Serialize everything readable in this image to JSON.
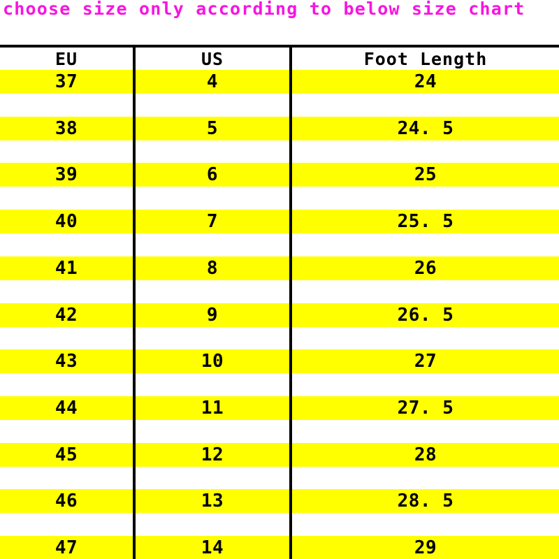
{
  "title": {
    "text": "choose size only according to below size chart",
    "color": "#f615e0"
  },
  "table": {
    "columns": [
      "EU",
      "US",
      "Foot Length"
    ],
    "stripe_color": "#ffff00",
    "border_color": "#000000",
    "rows": [
      {
        "eu": "37",
        "us": "4",
        "foot": "24"
      },
      {
        "eu": "38",
        "us": "5",
        "foot": "24. 5"
      },
      {
        "eu": "39",
        "us": "6",
        "foot": "25"
      },
      {
        "eu": "40",
        "us": "7",
        "foot": "25. 5"
      },
      {
        "eu": "41",
        "us": "8",
        "foot": "26"
      },
      {
        "eu": "42",
        "us": "9",
        "foot": "26. 5"
      },
      {
        "eu": "43",
        "us": "10",
        "foot": "27"
      },
      {
        "eu": "44",
        "us": "11",
        "foot": "27. 5"
      },
      {
        "eu": "45",
        "us": "12",
        "foot": "28"
      },
      {
        "eu": "46",
        "us": "13",
        "foot": "28. 5"
      },
      {
        "eu": "47",
        "us": "14",
        "foot": "29"
      }
    ]
  }
}
